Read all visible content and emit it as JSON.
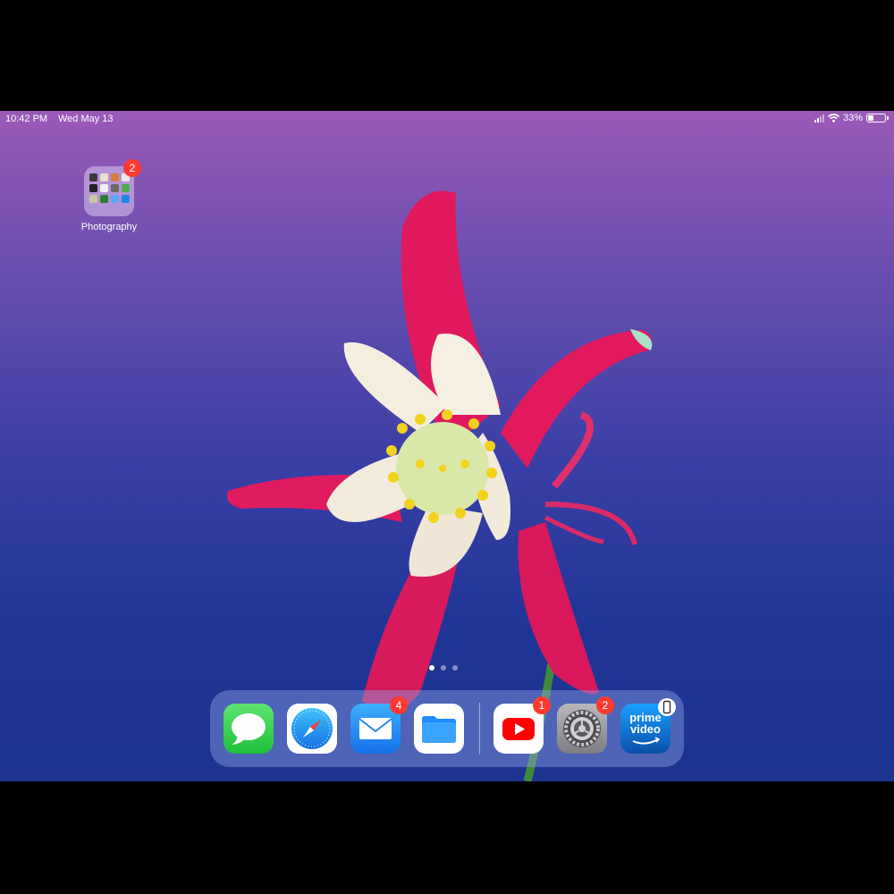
{
  "status_bar": {
    "time": "10:42 PM",
    "date": "Wed May 13",
    "battery_percent": "33%",
    "battery_level": 0.33
  },
  "home": {
    "folder": {
      "label": "Photography",
      "badge": "2",
      "icon": "folder-icon"
    },
    "page_count": 3,
    "current_page": 1
  },
  "dock": {
    "apps": [
      {
        "name": "Messages",
        "icon": "messages-icon",
        "color": "#34c759"
      },
      {
        "name": "Safari",
        "icon": "safari-icon",
        "color": "#1e88e5"
      },
      {
        "name": "Mail",
        "icon": "mail-icon",
        "color": "#1a8cff",
        "badge": "4"
      },
      {
        "name": "Files",
        "icon": "files-icon",
        "color": "#1e7ff0"
      },
      {
        "name": "YouTube",
        "icon": "youtube-icon",
        "color": "#ff0000",
        "badge": "1"
      },
      {
        "name": "Settings",
        "icon": "settings-gear-icon",
        "color": "#8e8e93",
        "badge": "2"
      },
      {
        "name": "Prime Video",
        "icon": "prime-video-icon",
        "color": "#1a98ff",
        "logo_text": "prime video"
      }
    ]
  },
  "colors": {
    "badge": "#ff3b30",
    "wallpaper_top": "#9b5ab8",
    "wallpaper_bottom": "#1c3490"
  }
}
